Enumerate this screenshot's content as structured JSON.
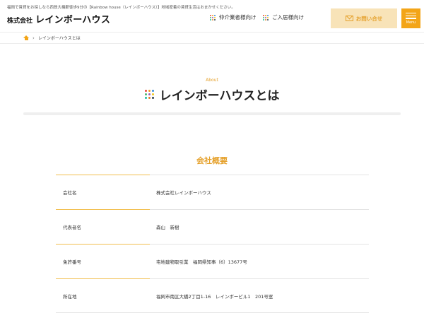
{
  "header": {
    "tagline": "福岡で賃貸をお探しなら西鉄大橋駅徒歩9分の【Rainbow house（レインボーハウス）】地域密着の賃貸生活はおまかせください。",
    "logo_prefix": "株式会社",
    "logo_name": "レインボーハウス",
    "nav": [
      {
        "label": "仲介業者様向け",
        "icon": "grid-dots-icon"
      },
      {
        "label": "ご入居様向け",
        "icon": "grid-dots-icon"
      }
    ],
    "contact_label": "お問い合せ",
    "contact_icon": "mail-icon",
    "menu_label": "Menu",
    "menu_icon": "hamburger-icon"
  },
  "breadcrumb": {
    "home_icon": "home-icon",
    "current": "レインボーハウスとは"
  },
  "about": {
    "subtitle": "About",
    "title": "レインボーハウスとは"
  },
  "company": {
    "section_title": "会社概要",
    "rows": [
      {
        "label": "会社名",
        "value": "株式会社レインボーハウス"
      },
      {
        "label": "代表者名",
        "value": "森山　新樹"
      },
      {
        "label": "免許番号",
        "value": "宅地建物取引業　福岡県知事（6）13677号"
      },
      {
        "label": "所在地",
        "value": "福岡市南区大橋2丁目1-16　レインボービル1　201号室"
      }
    ]
  },
  "colors": {
    "accent": "#f3a518",
    "accent_text": "#e5a02a",
    "contact_bg": "#f8e3b8",
    "dot_palette": [
      "#e8453c",
      "#f3a518",
      "#3a8ddb",
      "#48b56a",
      "#9b59b6",
      "#f0c419",
      "#1abc9c",
      "#e67e22",
      "#2c3e50"
    ]
  }
}
